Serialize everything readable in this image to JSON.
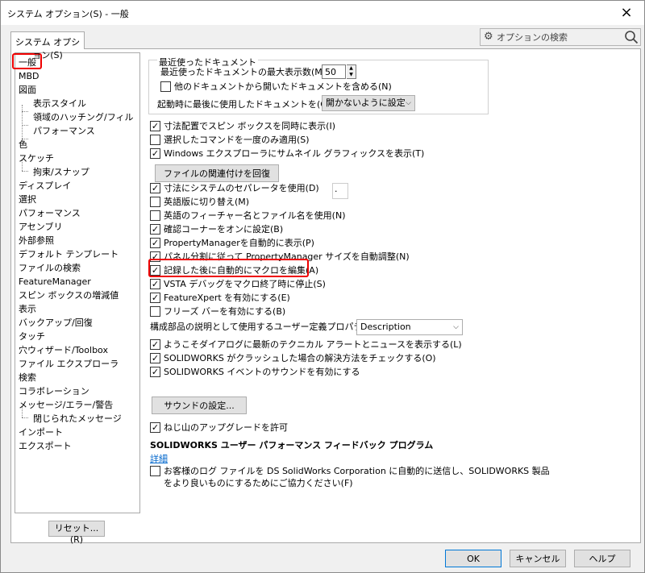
{
  "window": {
    "title": "システム オプション(S) - 一般",
    "close": "×"
  },
  "tab": {
    "label": "システム オプション(S)"
  },
  "search": {
    "placeholder": "オプションの検索"
  },
  "tree": {
    "items": [
      {
        "label": "一般",
        "level": 0
      },
      {
        "label": "MBD",
        "level": 0
      },
      {
        "label": "図面",
        "level": 0
      },
      {
        "label": "表示スタイル",
        "level": 1
      },
      {
        "label": "領域のハッチング/フィル",
        "level": 1
      },
      {
        "label": "パフォーマンス",
        "level": 1
      },
      {
        "label": "色",
        "level": 0
      },
      {
        "label": "スケッチ",
        "level": 0
      },
      {
        "label": "拘束/スナップ",
        "level": 1
      },
      {
        "label": "ディスプレイ",
        "level": 0
      },
      {
        "label": "選択",
        "level": 0
      },
      {
        "label": "パフォーマンス",
        "level": 0
      },
      {
        "label": "アセンブリ",
        "level": 0
      },
      {
        "label": "外部参照",
        "level": 0
      },
      {
        "label": "デフォルト テンプレート",
        "level": 0
      },
      {
        "label": "ファイルの検索",
        "level": 0
      },
      {
        "label": "FeatureManager",
        "level": 0
      },
      {
        "label": "スピン ボックスの増減値",
        "level": 0
      },
      {
        "label": "表示",
        "level": 0
      },
      {
        "label": "バックアップ/回復",
        "level": 0
      },
      {
        "label": "タッチ",
        "level": 0
      },
      {
        "label": "穴ウィザード/Toolbox",
        "level": 0
      },
      {
        "label": "ファイル エクスプローラ",
        "level": 0
      },
      {
        "label": "検索",
        "level": 0
      },
      {
        "label": "コラボレーション",
        "level": 0
      },
      {
        "label": "メッセージ/エラー/警告",
        "level": 0
      },
      {
        "label": "閉じられたメッセージ",
        "level": 1
      },
      {
        "label": "インポート",
        "level": 0
      },
      {
        "label": "エクスポート",
        "level": 0
      }
    ],
    "reset_label": "リセット...(R)"
  },
  "recent": {
    "group_title": "最近使ったドキュメント",
    "max_label": "最近使ったドキュメントの最大表示数(M):",
    "max_value": "50",
    "include_label": "他のドキュメントから開いたドキュメントを含める(N)",
    "include_checked": false,
    "startup_label": "起動時に最後に使用したドキュメントを(O):",
    "startup_value": "開かないように設定"
  },
  "options": [
    {
      "label": "寸法配置でスピン ボックスを同時に表示(I)",
      "checked": true
    },
    {
      "label": "選択したコマンドを一度のみ適用(S)",
      "checked": false
    },
    {
      "label": "Windows エクスプローラにサムネイル グラフィックスを表示(T)",
      "checked": true
    }
  ],
  "restore_assoc_label": "ファイルの関連付けを回復",
  "options2": [
    {
      "label": "寸法にシステムのセパレータを使用(D)",
      "checked": true
    },
    {
      "label": "英語版に切り替え(M)",
      "checked": false
    },
    {
      "label": "英語のフィーチャー名とファイル名を使用(N)",
      "checked": false
    },
    {
      "label": "確認コーナーをオンに設定(B)",
      "checked": true
    },
    {
      "label": "PropertyManagerを自動的に表示(P)",
      "checked": true
    },
    {
      "label": "パネル分割に従って PropertyManager サイズを自動調整(N)",
      "checked": true
    },
    {
      "label": "記録した後に自動的にマクロを編集(A)",
      "checked": true
    },
    {
      "label": "VSTA デバッグをマクロ終了時に停止(S)",
      "checked": true
    },
    {
      "label": "FeatureXpert を有効にする(E)",
      "checked": true
    },
    {
      "label": "フリーズ バーを有効にする(B)",
      "checked": false
    }
  ],
  "separator_value": ".",
  "description": {
    "label": "構成部品の説明として使用するユーザー定義プロパティ:",
    "value": "Description"
  },
  "options3": [
    {
      "label": "ようこそダイアログに最新のテクニカル アラートとニュースを表示する(L)",
      "checked": true
    },
    {
      "label": "SOLIDWORKS がクラッシュした場合の解決方法をチェックする(O)",
      "checked": true
    },
    {
      "label": "SOLIDWORKS イベントのサウンドを有効にする",
      "checked": true
    }
  ],
  "sound_button": "サウンドの設定...",
  "thread_upgrade": {
    "label": "ねじ山のアップグレードを許可",
    "checked": true
  },
  "perf_program": {
    "title": "SOLIDWORKS ユーザー パフォーマンス フィードバック プログラム",
    "detail_link": "詳細",
    "send_label_1": "お客様のログ ファイルを DS SolidWorks Corporation に自動的に送信し、SOLIDWORKS 製品",
    "send_label_2": "をより良いものにするためにご協力ください(F)",
    "send_checked": false
  },
  "footer": {
    "ok": "OK",
    "cancel": "キャンセル",
    "help": "ヘルプ"
  },
  "colors": {
    "highlight": "#e00000",
    "link": "#0066cc"
  }
}
